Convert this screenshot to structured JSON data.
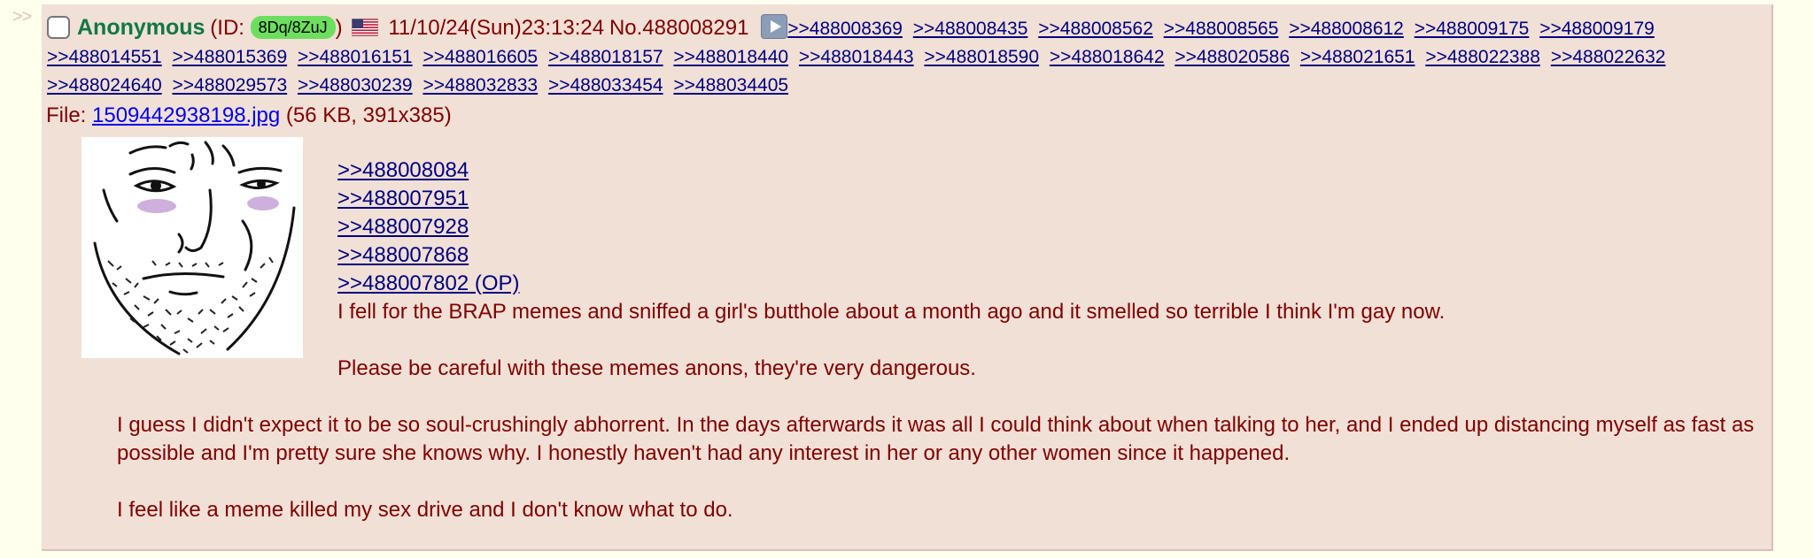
{
  "post": {
    "side_marker": ">>",
    "name": "Anonymous",
    "id_prefix": "(ID: ",
    "id": "8Dq/8ZuJ",
    "id_suffix": ")",
    "datetime": "11/10/24(Sun)23:13:24",
    "post_number": "No.488008291",
    "backlinks": [
      ">>488008369",
      ">>488008435",
      ">>488008562",
      ">>488008565",
      ">>488008612",
      ">>488009175",
      ">>488009179",
      ">>488014551",
      ">>488015369",
      ">>488016151",
      ">>488016605",
      ">>488018157",
      ">>488018440",
      ">>488018443",
      ">>488018590",
      ">>488018642",
      ">>488020586",
      ">>488021651",
      ">>488022388",
      ">>488022632",
      ">>488024640",
      ">>488029573",
      ">>488030239",
      ">>488032833",
      ">>488033454",
      ">>488034405"
    ],
    "file_label": "File: ",
    "file_name": "1509442938198.jpg",
    "file_meta": " (56 KB, 391x385)",
    "quote_links": [
      ">>488008084",
      ">>488007951",
      ">>488007928",
      ">>488007868",
      ">>488007802 (OP)"
    ],
    "message_1": "I fell for the BRAP memes and sniffed a girl's butthole about a month ago and it smelled so terrible I think I'm gay now.",
    "message_2": "Please be careful with these memes anons, they're very dangerous.",
    "message_3": "I guess I didn't expect it to be so soul-crushingly abhorrent. In the days afterwards it was all I could think about when talking to her, and I ended up distancing myself as fast as possible and I'm pretty sure she knows why. I honestly haven't had any interest in her or any other women since it happened.",
    "message_4": "I feel like a meme killed my sex drive and I don't know what to do.",
    "flag_icon": "us-flag-icon",
    "thumbnail_icon": "wojak-face-thumbnail",
    "colors": {
      "background": "#ffffee",
      "post_bg": "#f0e0d6",
      "text": "#800000",
      "name": "#117743",
      "link": "#000080",
      "id_badge": "#6dde5f"
    }
  }
}
